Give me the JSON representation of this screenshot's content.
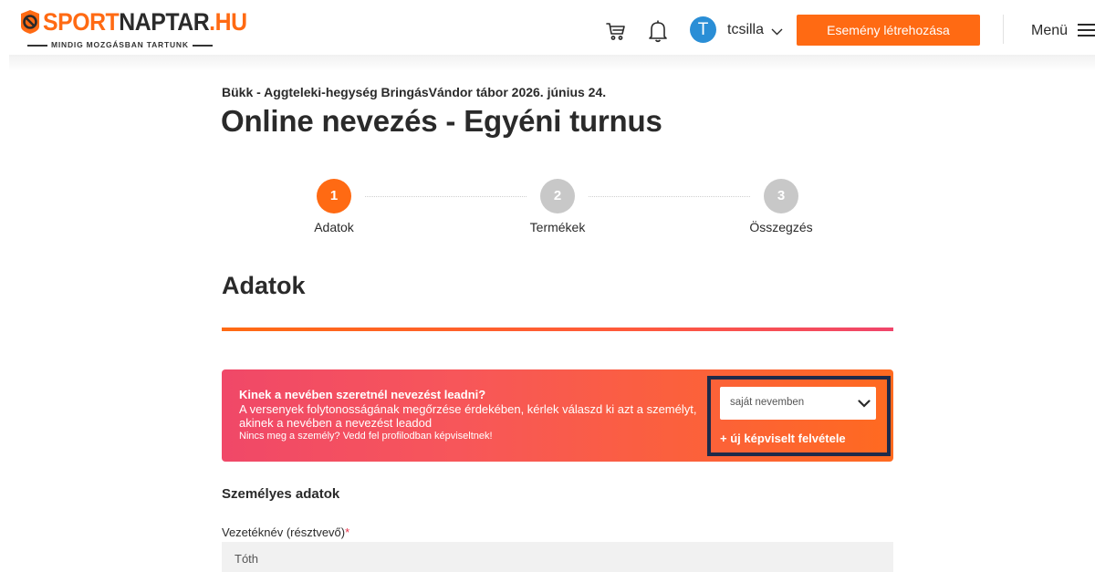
{
  "header": {
    "logo": {
      "part1": "SPORT",
      "part2": "NAPTAR",
      "part3": ".HU",
      "tagline": "MINDIG MOZGÁSBAN TARTUNK"
    },
    "avatar_letter": "T",
    "username": "tcsilla",
    "create_event_label": "Esemény létrehozása",
    "menu_label": "Menü",
    "accent_color": "#ff6a13"
  },
  "event": {
    "name": "Bükk - Aggteleki-hegység BringásVándor tábor 2026. június 24.",
    "page_title": "Online nevezés - Egyéni turnus"
  },
  "stepper": {
    "steps": [
      {
        "number": "1",
        "label": "Adatok",
        "active": true
      },
      {
        "number": "2",
        "label": "Termékek",
        "active": false
      },
      {
        "number": "3",
        "label": "Összegzés",
        "active": false
      }
    ]
  },
  "section": {
    "title": "Adatok"
  },
  "representative": {
    "question": "Kinek a nevében szeretnél nevezést leadni?",
    "description": "A versenyek folytonosságának megőrzése érdekében, kérlek válaszd ki azt a személyt, akinek a nevében a nevezést leadod",
    "hint": "Nincs meg a személy? Vedd fel profilodban képviseltnek!",
    "selected": "saját nevemben",
    "add_link": "+ új képviselt felvétele"
  },
  "form": {
    "section_title": "Személyes adatok",
    "fields": [
      {
        "label": "Vezetéknév (résztvevő)",
        "required_mark": "*",
        "value": "Tóth"
      }
    ]
  }
}
